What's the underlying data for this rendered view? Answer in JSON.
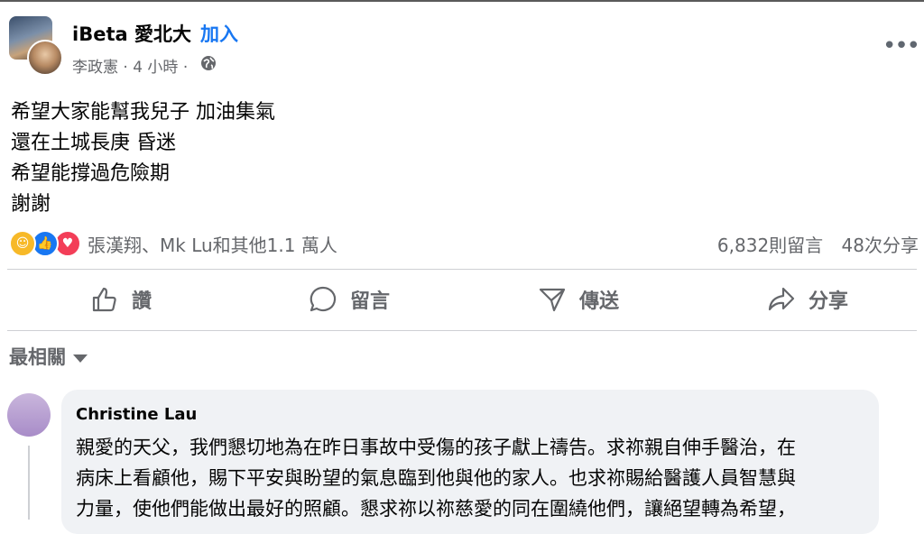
{
  "post": {
    "group_name": "iBeta 愛北大",
    "separator": "·",
    "join_label": "加入",
    "meta": "李政憲 · 4 小時 ·",
    "body_lines": [
      "希望大家能幫我兒子 加油集氣",
      "還在土城長庚 昏迷",
      "希望能撐過危險期",
      "謝謝"
    ],
    "reactions_text": "張漢翔、Mk Lu和其他1.1 萬人",
    "comments_count": "6,832則留言",
    "shares_count": "48次分享",
    "reaction_icons": [
      "care-icon",
      "like-icon",
      "love-icon"
    ]
  },
  "actions": {
    "like": "讚",
    "comment": "留言",
    "send": "傳送",
    "share": "分享"
  },
  "sort": {
    "label": "最相關"
  },
  "comment": {
    "author": "Christine Lau",
    "lines": [
      "親愛的天父，我們懇切地為在昨日事故中受傷的孩子獻上禱告。求祢親自伸手醫治，在",
      "病床上看顧他，賜下平安與盼望的氣息臨到他與他的家人。也求祢賜給醫護人員智慧與",
      "力量，使他們能做出最好的照顧。懇求祢以祢慈愛的同在圍繞他們，讓絕望轉為希望，"
    ]
  },
  "colors": {
    "link_blue": "#1877f2",
    "muted_text": "#65676b",
    "bubble_bg": "#f0f2f5"
  }
}
